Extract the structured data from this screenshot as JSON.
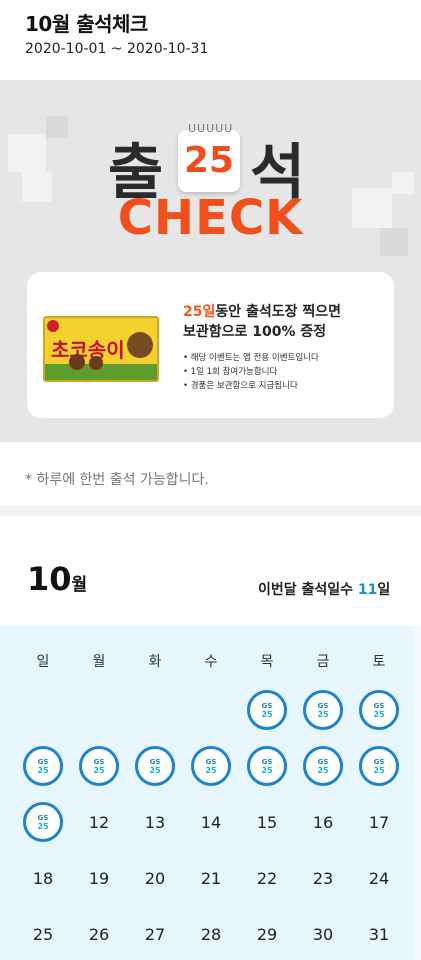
{
  "header": {
    "title": "10월 출석체크",
    "period": "2020-10-01 ~ 2020-10-31"
  },
  "banner": {
    "logo_left": "출",
    "logo_right": "석",
    "logo_day": "25",
    "logo_check": "CHECK",
    "product_name": "초코송이",
    "prize_highlight": "25일",
    "prize_line1_rest": "동안 출석도장 찍으면",
    "prize_line2": "보관함으로 100% 증정",
    "notes": [
      "• 해당 이벤트는 앱 전용 이벤트입니다",
      "• 1일 1회 참여가능합니다",
      "• 경품은 보관함으로 지급됩니다"
    ],
    "colors": {
      "accent": "#f1501c",
      "background": "#e6e6e6"
    }
  },
  "notice": "* 하루에 한번 출석 가능합니다.",
  "month": {
    "number": "10",
    "suffix": "월",
    "attend_label": "이번달 출석일수 ",
    "attend_count": "11",
    "attend_suffix": "일"
  },
  "calendar": {
    "weekdays": [
      "일",
      "월",
      "화",
      "수",
      "목",
      "금",
      "토"
    ],
    "stamp_line1": "GS",
    "stamp_line2": "25",
    "weeks": [
      [
        "",
        "",
        "",
        "",
        "stamp",
        "stamp",
        "stamp"
      ],
      [
        "stamp",
        "stamp",
        "stamp",
        "stamp",
        "stamp",
        "stamp",
        "stamp"
      ],
      [
        "stamp",
        "12",
        "13",
        "14",
        "15",
        "16",
        "17"
      ],
      [
        "18",
        "19",
        "20",
        "21",
        "22",
        "23",
        "24"
      ],
      [
        "25",
        "26",
        "27",
        "28",
        "29",
        "30",
        "31"
      ]
    ],
    "colors": {
      "stamp_border": "#1b84d2",
      "background": "#e7f5fd",
      "highlight": "#1a8cd8"
    }
  }
}
